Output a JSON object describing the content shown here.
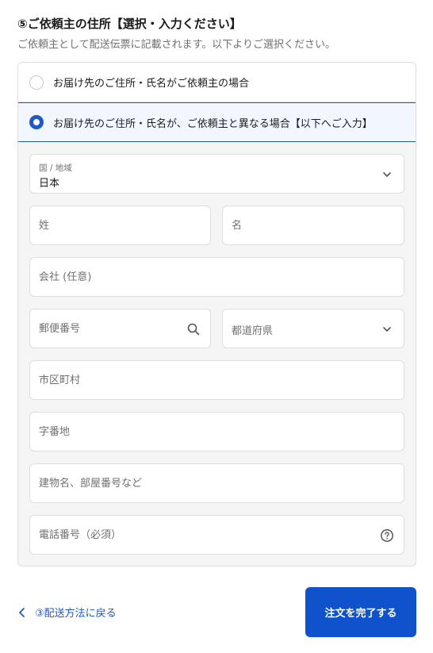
{
  "section": {
    "title": "⑤ご依頼主の住所【選択・入力ください】",
    "subtitle": "ご依頼主として配送伝票に記載されます。以下よりご選択ください。"
  },
  "options": [
    {
      "label": "お届け先のご住所・氏名がご依頼主の場合",
      "selected": false
    },
    {
      "label": "お届け先のご住所・氏名が、ご依頼主と異なる場合【以下へご入力】",
      "selected": true
    }
  ],
  "form": {
    "country": {
      "label": "国 / 地域",
      "value": "日本",
      "icon": "chevron-down-icon"
    },
    "last_name": {
      "placeholder": "姓"
    },
    "first_name": {
      "placeholder": "名"
    },
    "company": {
      "placeholder": "会社 (任意)"
    },
    "postal_code": {
      "placeholder": "郵便番号",
      "icon": "search-icon"
    },
    "prefecture": {
      "placeholder": "都道府県",
      "icon": "chevron-down-icon"
    },
    "city": {
      "placeholder": "市区町村"
    },
    "address": {
      "placeholder": "字番地"
    },
    "building": {
      "placeholder": "建物名、部屋番号など"
    },
    "phone": {
      "placeholder": "電話番号（必須）",
      "icon": "help-circle-icon"
    }
  },
  "footer": {
    "back_label": "③配送方法に戻る",
    "back_icon": "chevron-left-icon",
    "submit_label": "注文を完了する"
  },
  "colors": {
    "accent": "#1f5ac2",
    "button": "#1052cc",
    "border": "#dedede",
    "panel_bg": "#f5f5f5"
  }
}
